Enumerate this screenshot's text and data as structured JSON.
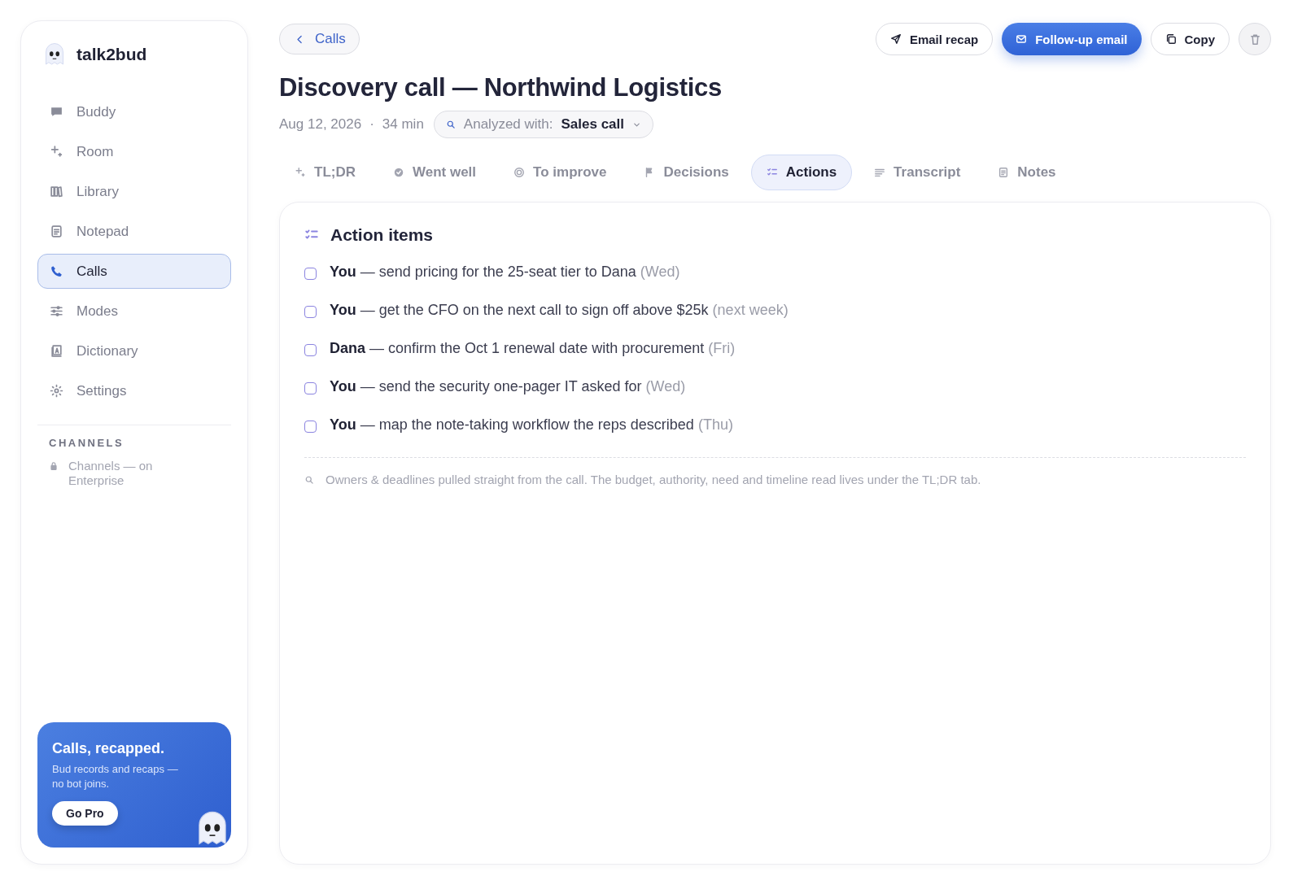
{
  "brand": {
    "name": "talk2bud"
  },
  "sidebar": {
    "items": [
      {
        "label": "Buddy",
        "selected": false
      },
      {
        "label": "Room",
        "selected": false
      },
      {
        "label": "Library",
        "selected": false
      },
      {
        "label": "Notepad",
        "selected": false
      },
      {
        "label": "Calls",
        "selected": true
      },
      {
        "label": "Modes",
        "selected": false
      },
      {
        "label": "Dictionary",
        "selected": false
      },
      {
        "label": "Settings",
        "selected": false
      }
    ],
    "section_title": "CHANNELS",
    "locked_note": "Channels — on Enterprise",
    "promo": {
      "title": "Calls, recapped.",
      "text": "Bud records and recaps — no bot joins.",
      "button": "Go Pro"
    }
  },
  "header": {
    "back": "Calls",
    "actions": [
      {
        "label": "Email recap",
        "kind": "outline"
      },
      {
        "label": "Follow-up email",
        "kind": "primary"
      },
      {
        "label": "Copy",
        "kind": "outline"
      },
      {
        "kind": "icon"
      }
    ],
    "title": "Discovery call — Northwind Logistics",
    "date": "Aug 12, 2026",
    "separator": "·",
    "duration": "34 min",
    "analyzer": {
      "label": "Analyzed with:",
      "value": "Sales call"
    }
  },
  "tabs": [
    {
      "label": "TL;DR",
      "selected": false
    },
    {
      "label": "Went well",
      "selected": false
    },
    {
      "label": "To improve",
      "selected": false
    },
    {
      "label": "Decisions",
      "selected": false
    },
    {
      "label": "Actions",
      "selected": true
    },
    {
      "label": "Transcript",
      "selected": false
    },
    {
      "label": "Notes",
      "selected": false
    }
  ],
  "panel": {
    "title": "Action items",
    "items": [
      {
        "owner": "You",
        "task": "— send pricing for the 25-seat tier to Dana",
        "due": "(Wed)",
        "checked": false
      },
      {
        "owner": "You",
        "task": "— get the CFO on the next call to sign off above $25k",
        "due": "(next week)",
        "checked": false
      },
      {
        "owner": "Dana",
        "task": "— confirm the Oct 1 renewal date with procurement",
        "due": "(Fri)",
        "checked": false
      },
      {
        "owner": "You",
        "task": "— send the security one-pager IT asked for",
        "due": "(Wed)",
        "checked": false
      },
      {
        "owner": "You",
        "task": "— map the note-taking workflow the reps described",
        "due": "(Thu)",
        "checked": false
      }
    ],
    "footnote": "Owners & deadlines pulled straight from the call. The budget, authority, need and timeline read lives under the TL;DR tab."
  }
}
